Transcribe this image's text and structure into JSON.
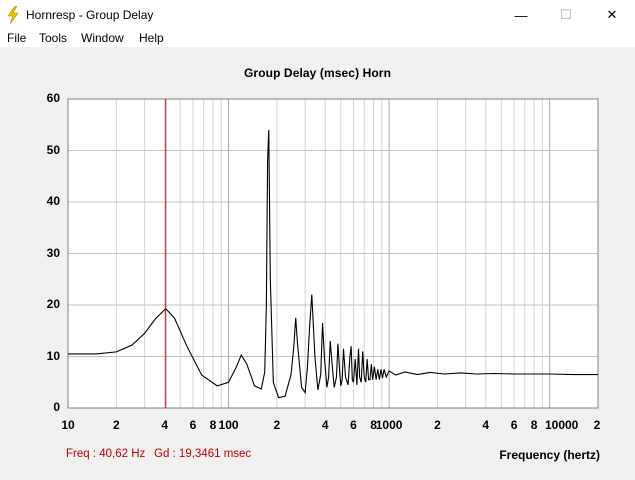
{
  "window": {
    "title": "Hornresp - Group Delay",
    "minimize": "—",
    "maximize": "☐",
    "close": "✕"
  },
  "menu": [
    "File",
    "Tools",
    "Window",
    "Help"
  ],
  "chart_title": "Group Delay (msec)    Horn",
  "colors": {
    "grid": "#c0c0c0",
    "curve": "#000000",
    "cursor": "#cc0000",
    "status": "#c00000"
  },
  "status": {
    "freq": "Freq : 40,62 Hz",
    "gd": "Gd : 19,3461 msec"
  },
  "chart_data": {
    "type": "line",
    "title": "Group Delay (msec)    Horn",
    "xlabel": "Frequency (hertz)",
    "ylabel": "",
    "xscale": "log",
    "xlim": [
      10,
      20000
    ],
    "ylim": [
      0,
      60
    ],
    "grid": true,
    "y_ticks": [
      "0",
      "10",
      "20",
      "30",
      "40",
      "50",
      "60"
    ],
    "x_ticks": [
      {
        "value": 10,
        "label": "10"
      },
      {
        "value": 20,
        "label": "2"
      },
      {
        "value": 40,
        "label": "4"
      },
      {
        "value": 60,
        "label": "6"
      },
      {
        "value": 80,
        "label": "8"
      },
      {
        "value": 100,
        "label": "100"
      },
      {
        "value": 200,
        "label": "2"
      },
      {
        "value": 400,
        "label": "4"
      },
      {
        "value": 600,
        "label": "6"
      },
      {
        "value": 800,
        "label": "8"
      },
      {
        "value": 1000,
        "label": "1000"
      },
      {
        "value": 2000,
        "label": "2"
      },
      {
        "value": 4000,
        "label": "4"
      },
      {
        "value": 6000,
        "label": "6"
      },
      {
        "value": 8000,
        "label": "8"
      },
      {
        "value": 10000,
        "label": "10000"
      },
      {
        "value": 20000,
        "label": "2"
      }
    ],
    "cursor_freq": 40.62,
    "series": [
      {
        "x": [
          10,
          15,
          20,
          25,
          30,
          35,
          40.6,
          46,
          55,
          68,
          85,
          100,
          112,
          120,
          130,
          145,
          160,
          168,
          172,
          175,
          178,
          182,
          190,
          205,
          225,
          245,
          255,
          262,
          268,
          285,
          300,
          310,
          320,
          330,
          345,
          360,
          375,
          385,
          395,
          410,
          420,
          430,
          440,
          455,
          470,
          480,
          490,
          500,
          510,
          520,
          535,
          555,
          570,
          580,
          590,
          600,
          615,
          630,
          645,
          655,
          670,
          685,
          700,
          715,
          730,
          745,
          760,
          775,
          790,
          810,
          830,
          850,
          870,
          890,
          910,
          930,
          960,
          1000,
          1100,
          1250,
          1500,
          1800,
          2200,
          2800,
          3500,
          4500,
          6000,
          8000,
          10000,
          14000,
          20000
        ],
        "y": [
          10.5,
          10.5,
          10.9,
          12.2,
          14.5,
          17.3,
          19.3,
          17.5,
          12.0,
          6.4,
          4.3,
          5.0,
          8.0,
          10.3,
          8.5,
          4.3,
          3.7,
          7.0,
          20.0,
          48.0,
          54.0,
          25.0,
          5.0,
          2.0,
          2.3,
          6.5,
          12.0,
          17.5,
          13.0,
          4.0,
          3.0,
          8.0,
          16.0,
          22.0,
          10.0,
          3.5,
          6.5,
          16.5,
          10.0,
          4.0,
          6.0,
          13.0,
          9.0,
          4.0,
          6.0,
          12.5,
          8.0,
          4.3,
          5.5,
          11.5,
          6.0,
          4.5,
          10.0,
          12.0,
          5.5,
          5.0,
          9.5,
          4.5,
          11.5,
          6.0,
          5.0,
          11.0,
          6.0,
          5.0,
          9.5,
          5.5,
          5.5,
          8.5,
          5.5,
          8.0,
          5.5,
          7.5,
          5.5,
          7.5,
          5.8,
          7.5,
          6.0,
          7.2,
          6.4,
          7.0,
          6.5,
          6.9,
          6.6,
          6.8,
          6.6,
          6.7,
          6.6,
          6.6,
          6.6,
          6.5,
          6.5
        ]
      }
    ]
  }
}
